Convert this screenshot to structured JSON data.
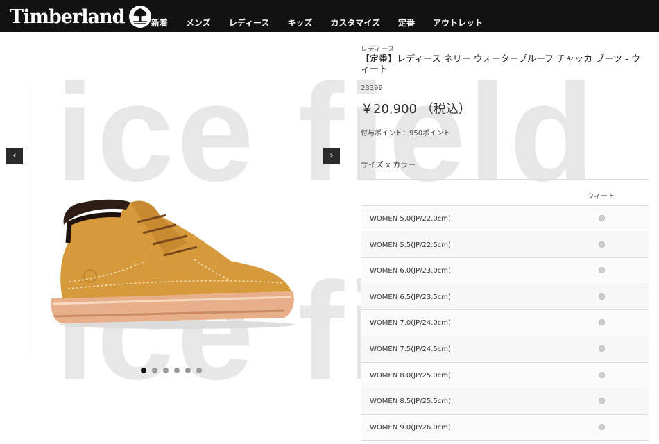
{
  "header": {
    "logo_text": "Timberland",
    "nav": [
      "新着",
      "メンズ",
      "レディース",
      "キッズ",
      "カスタマイズ",
      "定番",
      "アウトレット"
    ]
  },
  "watermark": {
    "text_top": "ice field",
    "text_bottom": "ice field"
  },
  "gallery": {
    "prev_label": "‹",
    "next_label": "›",
    "slide_count": 6,
    "active_slide": 1
  },
  "product": {
    "category": "レディース",
    "title": "【定番】レディース ネリー ウォータープルーフ チャッカ ブーツ - ウィート",
    "code": "23399",
    "price": "￥20,900 （税込）",
    "points": "付与ポイント：950ポイント",
    "variant_label": "サイズ x カラー"
  },
  "size_table": {
    "color_header": "ウィート",
    "sizes": [
      "WOMEN 5.0(JP/22.0cm)",
      "WOMEN 5.5(JP/22.5cm)",
      "WOMEN 6.0(JP/23.0cm)",
      "WOMEN 6.5(JP/23.5cm)",
      "WOMEN 7.0(JP/24.0cm)",
      "WOMEN 7.5(JP/24.5cm)",
      "WOMEN 8.0(JP/25.0cm)",
      "WOMEN 8.5(JP/25.5cm)",
      "WOMEN 9.0(JP/26.0cm)"
    ]
  },
  "colors": {
    "header_bg": "#121212",
    "boot_wheat": "#d69a3c",
    "watermark": "#e7e7e7"
  }
}
